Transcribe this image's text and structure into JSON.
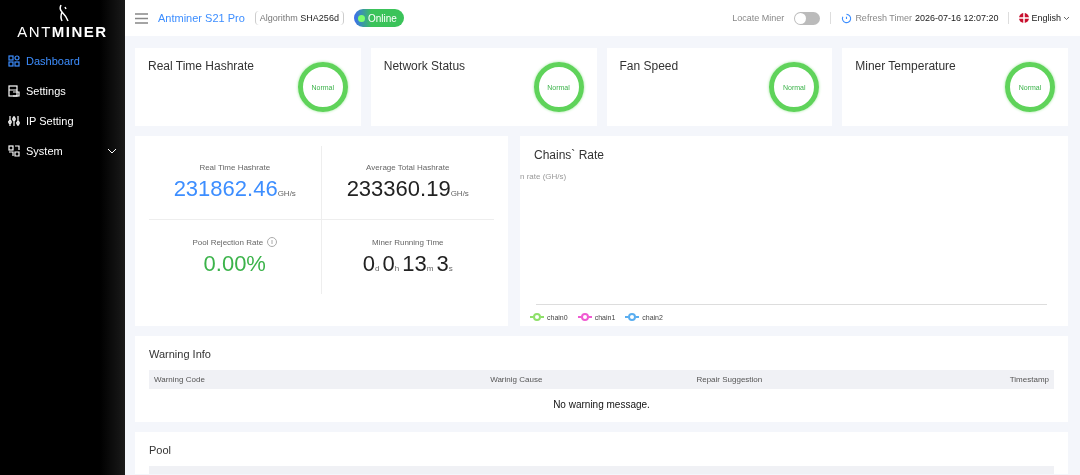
{
  "sidebar": {
    "logo": {
      "light": "ANT",
      "bold": "MINER"
    },
    "items": [
      {
        "label": "Dashboard",
        "selected": true
      },
      {
        "label": "Settings",
        "selected": false
      },
      {
        "label": "IP Setting",
        "selected": false
      },
      {
        "label": "System",
        "selected": false,
        "expanded": false
      }
    ]
  },
  "header": {
    "model": "Antminer S21 Pro",
    "algorithm_label": "Algorithm",
    "algorithm": "SHA256d",
    "status": "Online",
    "online": true,
    "locate_label": "Locate Miner",
    "locate_on": false,
    "refresh_label": "Refresh Timer",
    "refresh_time": "2026-07-16 12:07:20",
    "language": "English"
  },
  "status_cards": [
    {
      "title": "Real Time Hashrate",
      "status": "Normal"
    },
    {
      "title": "Network Status",
      "status": "Normal"
    },
    {
      "title": "Fan Speed",
      "status": "Normal"
    },
    {
      "title": "Miner Temperature",
      "status": "Normal"
    }
  ],
  "stats": {
    "realtime": {
      "label": "Real Time Hashrate",
      "value": "231862.46",
      "unit": "GH/s"
    },
    "average": {
      "label": "Average Total Hashrate",
      "value": "233360.19",
      "unit": "GH/s"
    },
    "rejection": {
      "label": "Pool Rejection Rate",
      "value": "0.00%"
    },
    "runtime": {
      "label": "Miner Running Time",
      "parts": [
        {
          "value": "0",
          "unit": "d"
        },
        {
          "value": "0",
          "unit": "h"
        },
        {
          "value": "13",
          "unit": "m"
        },
        {
          "value": "3",
          "unit": "s"
        }
      ]
    }
  },
  "chains_chart": {
    "title": "Chains` Rate",
    "axis_label": "n rate (GH/s)",
    "legend": [
      {
        "name": "chain0",
        "color": "#8ee06a"
      },
      {
        "name": "chain1",
        "color": "#f05ad2"
      },
      {
        "name": "chain2",
        "color": "#5aaef0"
      }
    ]
  },
  "warning_info": {
    "title": "Warning Info",
    "columns": [
      "Warning Code",
      "Warinig Cause",
      "Repair Suggestion",
      "Timestamp"
    ],
    "empty_message": "No warning message."
  },
  "pool": {
    "title": "Pool"
  }
}
